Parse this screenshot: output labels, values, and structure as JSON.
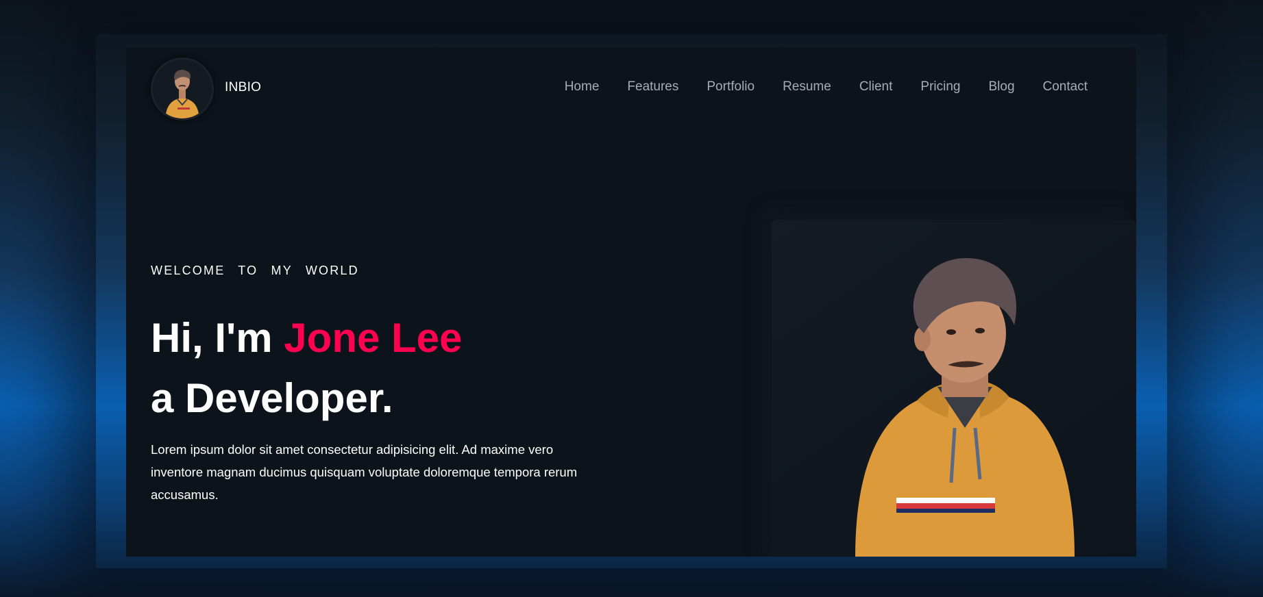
{
  "nav": {
    "brand": "INBIO",
    "items": [
      "Home",
      "Features",
      "Portfolio",
      "Resume",
      "Client",
      "Pricing",
      "Blog",
      "Contact"
    ]
  },
  "hero": {
    "welcome": "WELCOME TO MY WORLD",
    "greeting": "Hi, I'm ",
    "name": "Jone Lee",
    "role_line": "a Developer.",
    "description": "Lorem ipsum dolor sit amet consectetur adipisicing elit. Ad maxime vero inventore magnam ducimus quisquam voluptate doloremque tempora rerum accusamus."
  },
  "colors": {
    "accent": "#ff014f",
    "panel": "#0d131a",
    "nav_text": "#c4cfde"
  },
  "icons": {
    "avatar": "person-avatar",
    "portrait": "person-portrait"
  }
}
